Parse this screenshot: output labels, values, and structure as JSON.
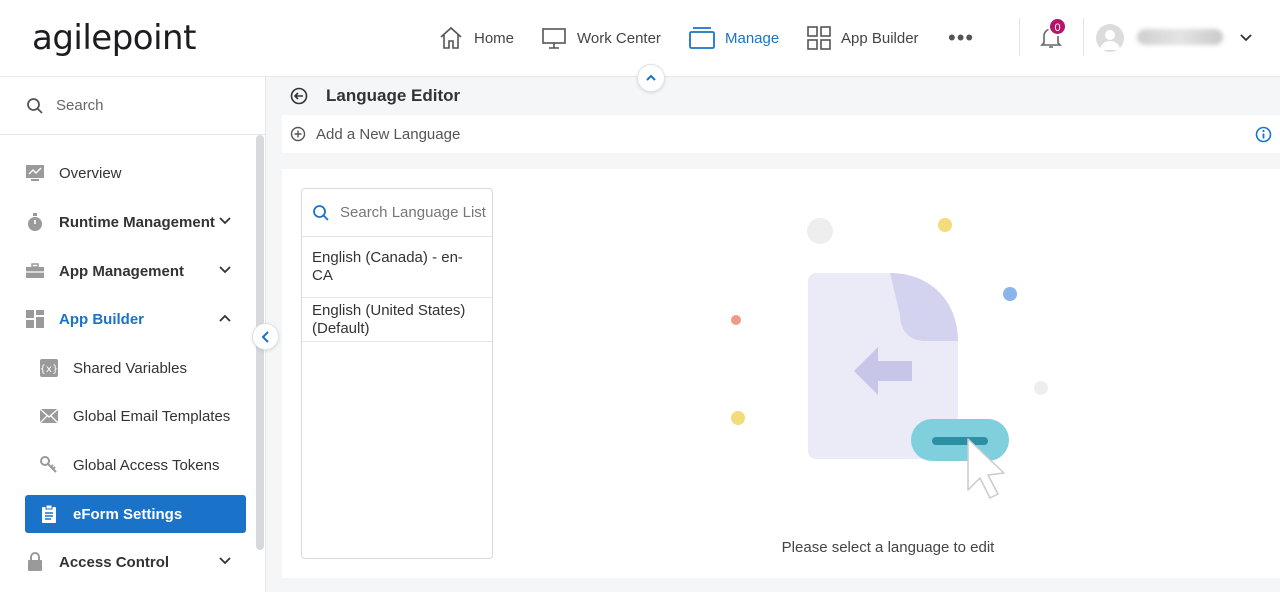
{
  "app": {
    "logo_text": "agilepoint"
  },
  "nav": {
    "home": "Home",
    "work_center": "Work Center",
    "manage": "Manage",
    "app_builder": "App Builder",
    "more": "•••"
  },
  "notifications": {
    "count": "0"
  },
  "colors": {
    "accent": "#1a73c8",
    "badge": "#b5146b"
  },
  "sidebar": {
    "search_placeholder": "Search",
    "items": [
      {
        "label": "Overview"
      },
      {
        "label": "Runtime Management"
      },
      {
        "label": "App Management"
      },
      {
        "label": "App Builder"
      },
      {
        "label": "Shared Variables"
      },
      {
        "label": "Global Email Templates"
      },
      {
        "label": "Global Access Tokens"
      },
      {
        "label": "eForm Settings"
      },
      {
        "label": "Access Control"
      }
    ]
  },
  "main": {
    "title": "Language Editor",
    "add_language": "Add a New Language",
    "search_placeholder": "Search Language List",
    "languages": [
      {
        "label": "English (Canada) - en-CA"
      },
      {
        "label": "English (United States) (Default)"
      }
    ],
    "empty_message": "Please select a language to edit"
  }
}
